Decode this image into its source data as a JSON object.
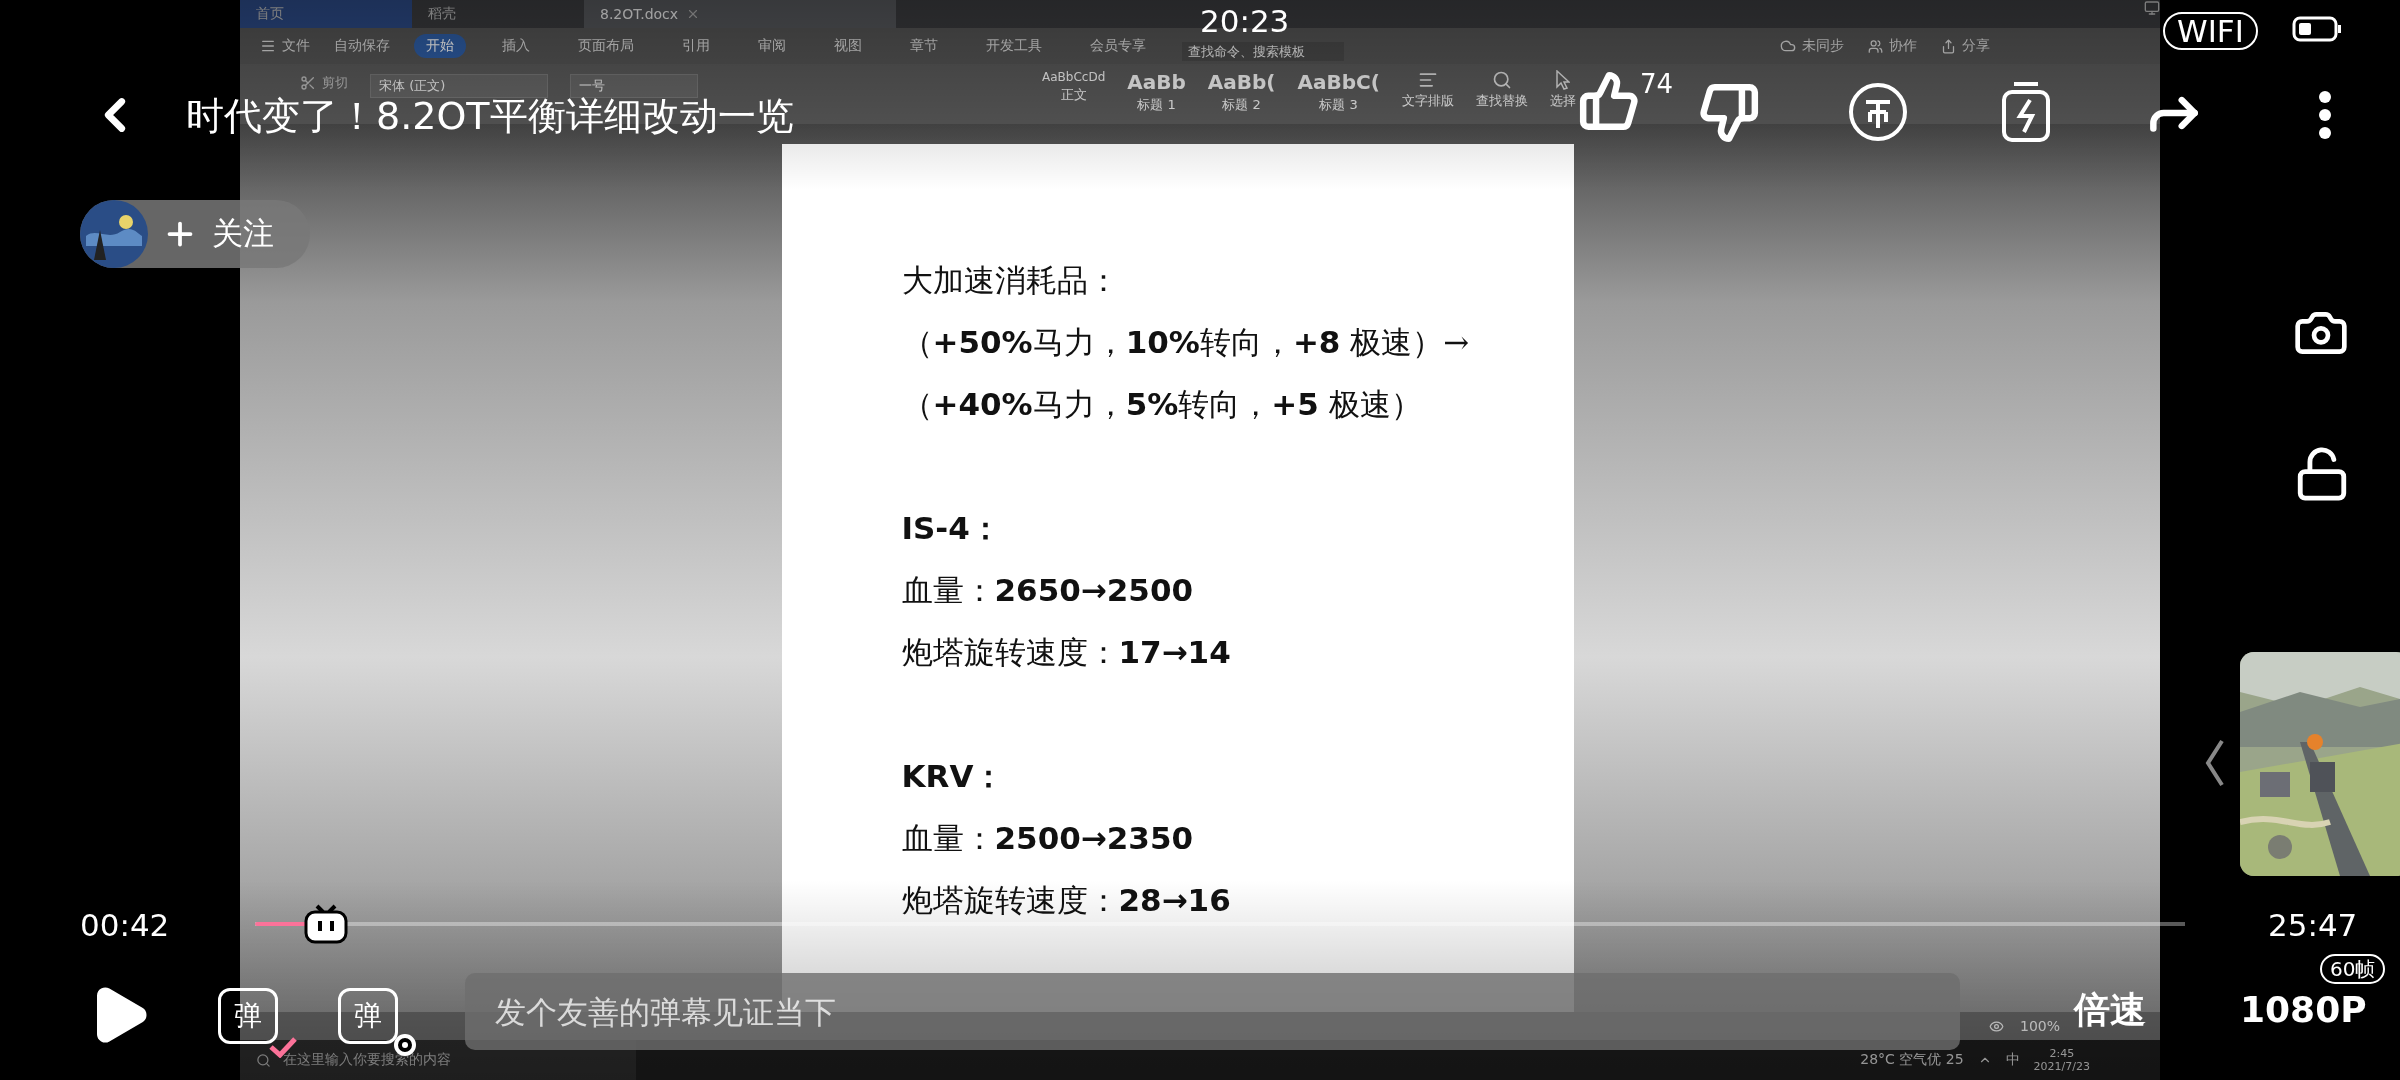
{
  "status_bar": {
    "time": "20:23",
    "network": "WIFI"
  },
  "player": {
    "title": "时代变了！8.2OT平衡详细改动一览",
    "likes": "74",
    "follow_label": "关注",
    "playing": false,
    "current_time": "00:42",
    "total_time": "25:47",
    "progress": {
      "level": 0.028
    },
    "danmaku_toggle": {
      "label": "弹",
      "on": true
    },
    "danmaku_settings": {
      "label": "弹"
    },
    "danmaku_input": {
      "placeholder": "发个友善的弹幕见证当下"
    },
    "speed": "倍速",
    "quality": "1080P",
    "fps": "60帧"
  },
  "wps": {
    "tabs": [
      {
        "label": "首页",
        "selected": false
      },
      {
        "label": "稻壳",
        "selected": false
      },
      {
        "label": "8.2OT.docx",
        "selected": true
      }
    ],
    "file_menu": "文件",
    "autosave": "自动保存",
    "ribbon_tabs": [
      {
        "label": "开始",
        "selected": true
      },
      {
        "label": "插入",
        "selected": false
      },
      {
        "label": "页面布局",
        "selected": false
      },
      {
        "label": "引用",
        "selected": false
      },
      {
        "label": "审阅",
        "selected": false
      },
      {
        "label": "视图",
        "selected": false
      },
      {
        "label": "章节",
        "selected": false
      },
      {
        "label": "开发工具",
        "selected": false
      },
      {
        "label": "会员专享",
        "selected": false
      }
    ],
    "search": {
      "placeholder": "查找命令、搜索模板"
    },
    "sync": "未同步",
    "collab": "协作",
    "share": "分享",
    "cut": "剪切",
    "font": "宋体 (正文)",
    "font_size": "一号",
    "styles": [
      {
        "sample": "AaBbCcDd",
        "name": "正文"
      },
      {
        "sample": "AaBb",
        "name": "标题 1"
      },
      {
        "sample": "AaBb(",
        "name": "标题 2"
      },
      {
        "sample": "AaBbC(",
        "name": "标题 3"
      }
    ],
    "tools": [
      "文字排版",
      "查找替换",
      "选择"
    ],
    "document": [
      {
        "kind": "line",
        "text": "大加速消耗品："
      },
      {
        "kind": "line",
        "text": "（**+50%**马力，**10%**转向，**+8** 极速）→"
      },
      {
        "kind": "line",
        "text": "（**+40%**马力，**5%**转向，**+5** 极速）"
      },
      {
        "kind": "gap"
      },
      {
        "kind": "line",
        "text": "**IS-4：**"
      },
      {
        "kind": "line",
        "text": "血量：**2650→2500**"
      },
      {
        "kind": "line",
        "text": "炮塔旋转速度：**17→14**"
      },
      {
        "kind": "gap"
      },
      {
        "kind": "line",
        "text": "**KRV：**"
      },
      {
        "kind": "line",
        "text": "血量：**2500→2350**"
      },
      {
        "kind": "line",
        "text": "炮塔旋转速度：**28→16**"
      }
    ],
    "zoom": "100%",
    "taskbar": {
      "search": {
        "placeholder": "在这里输入你要搜索的内容"
      },
      "weather": "28°C 空气优 25",
      "ime": "中",
      "clock": "2:45",
      "date": "2021/7/23"
    }
  }
}
